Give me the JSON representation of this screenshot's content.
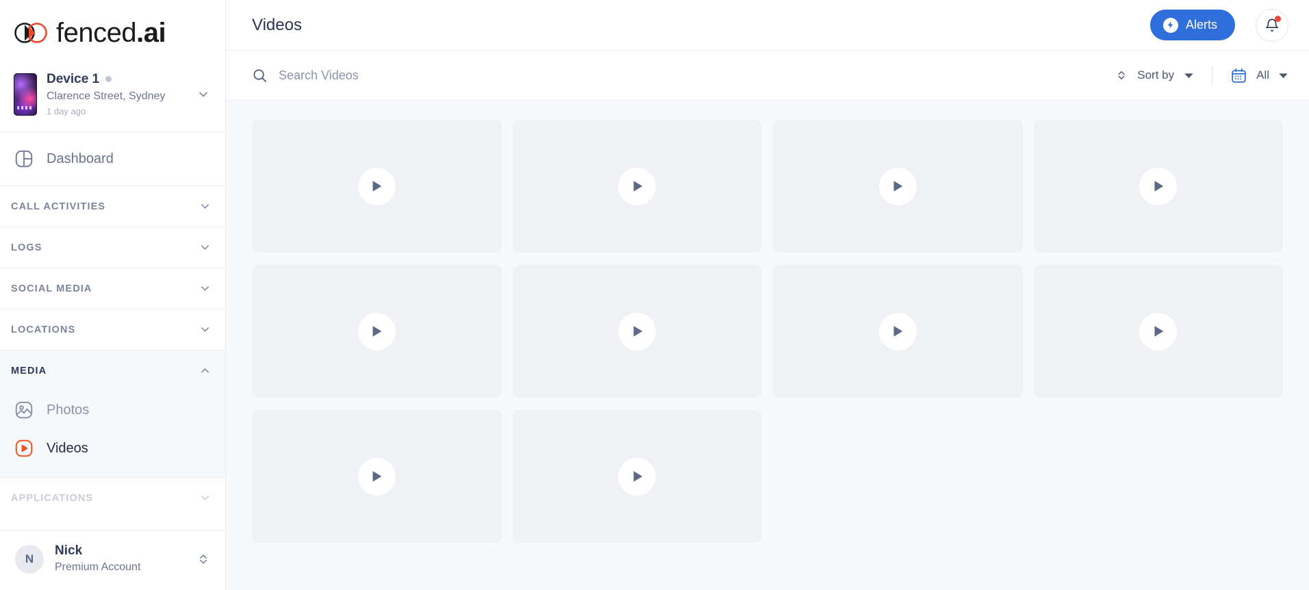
{
  "brand": {
    "name_light": "fenced",
    "name_bold": ".ai",
    "logo_icon": "interlocking-circles-logo",
    "logo_colors": {
      "dark": "#1b1b1b",
      "accent": "#e8472a"
    }
  },
  "device": {
    "name": "Device 1",
    "location": "Clarence Street, Sydney",
    "last_seen": "1 day ago",
    "status_dot_color": "#c3c8d4",
    "caret_icon": "chevron-down-icon"
  },
  "sidebar": {
    "dashboard": {
      "label": "Dashboard",
      "icon": "dashboard-layout-icon"
    },
    "sections": [
      {
        "id": "call-activities",
        "title": "CALL ACTIVITIES",
        "expanded": false,
        "chevron": "chevron-down-icon"
      },
      {
        "id": "logs",
        "title": "LOGS",
        "expanded": false,
        "chevron": "chevron-down-icon"
      },
      {
        "id": "social-media",
        "title": "SOCIAL MEDIA",
        "expanded": false,
        "chevron": "chevron-down-icon"
      },
      {
        "id": "locations",
        "title": "LOCATIONS",
        "expanded": false,
        "chevron": "chevron-down-icon"
      },
      {
        "id": "media",
        "title": "MEDIA",
        "expanded": true,
        "chevron": "chevron-up-icon"
      },
      {
        "id": "applications",
        "title": "APPLICATIONS",
        "expanded": false,
        "chevron": "chevron-down-icon"
      }
    ],
    "media_items": [
      {
        "id": "photos",
        "label": "Photos",
        "icon": "photo-image-icon",
        "active": false
      },
      {
        "id": "videos",
        "label": "Videos",
        "icon": "video-play-icon",
        "active": true
      }
    ],
    "active_accent_color": "#ef5223"
  },
  "user": {
    "initial": "N",
    "name": "Nick",
    "plan": "Premium Account",
    "caret_icon": "chevron-up-down-icon"
  },
  "header": {
    "title": "Videos",
    "alerts_button": {
      "label": "Alerts",
      "icon": "lightning-bolt-icon",
      "color": "#2f6fdb"
    },
    "notifications": {
      "icon": "bell-icon",
      "has_badge": true,
      "badge_color": "#f0453a"
    }
  },
  "filters": {
    "search": {
      "placeholder": "Search Videos",
      "value": "",
      "icon": "search-icon"
    },
    "sort": {
      "label": "Sort by",
      "icon": "sort-updown-icon",
      "caret": "caret-down-icon"
    },
    "date": {
      "label": "All",
      "icon": "calendar-icon",
      "caret": "caret-down-icon",
      "icon_color": "#2f6fdb"
    }
  },
  "videos": {
    "count": 10,
    "columns": 4,
    "items": [
      {
        "id": 1,
        "play_icon": "play-icon"
      },
      {
        "id": 2,
        "play_icon": "play-icon"
      },
      {
        "id": 3,
        "play_icon": "play-icon"
      },
      {
        "id": 4,
        "play_icon": "play-icon"
      },
      {
        "id": 5,
        "play_icon": "play-icon"
      },
      {
        "id": 6,
        "play_icon": "play-icon"
      },
      {
        "id": 7,
        "play_icon": "play-icon"
      },
      {
        "id": 8,
        "play_icon": "play-icon"
      },
      {
        "id": 9,
        "play_icon": "play-icon"
      },
      {
        "id": 10,
        "play_icon": "play-icon"
      }
    ]
  }
}
